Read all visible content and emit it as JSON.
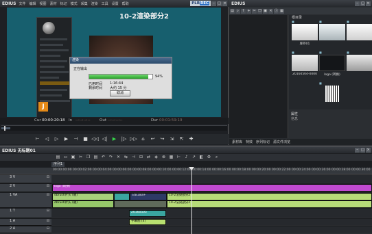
{
  "app": {
    "name": "EDIUS",
    "badge_plr": "PLR",
    "badge_rec": "REC"
  },
  "player": {
    "menu": [
      "文件",
      "编辑",
      "视图",
      "素材",
      "标记",
      "模式",
      "采集",
      "渲染",
      "工具",
      "设置",
      "帮助"
    ],
    "video_title": "10-2渲染部分2",
    "timecodes": {
      "cur_label": "Cur",
      "cur_value": "00:00:20:18",
      "in_label": "In",
      "in_value": "--:--:--:--",
      "out_label": "Out",
      "out_value": "--:--:--:--",
      "dur_label": "Dur",
      "dur_value": "00:01:59:19"
    },
    "scrub_progress": 0.04,
    "transport": [
      "⊢",
      "◁",
      "▷",
      "▶",
      "⊣",
      "■",
      "◁◁",
      "◁|",
      "▶",
      "|▷",
      "▷▷",
      "⌂",
      "↩",
      "↪",
      "⇲",
      "⇱",
      "✚"
    ]
  },
  "render_dialog": {
    "title": "渲染",
    "status": "正在输出",
    "progress": 0.94,
    "percent_text": "94%",
    "elapsed_label": "已用时间",
    "elapsed_value": "1:16:44",
    "remaining_label": "剩余时间",
    "remaining_value": "大约 15 分",
    "cancel_label": "取消"
  },
  "bin": {
    "title": "EDIUS",
    "path": "根目录",
    "clips": [
      {
        "num": "■",
        "name": "库存01",
        "thumb": "#d9d9d9"
      },
      {
        "num": "■",
        "name": "",
        "thumb": "#cfd8dc"
      },
      {
        "num": "■",
        "name": "",
        "thumb": "#e6e6e6"
      },
      {
        "num": "■",
        "name": "",
        "thumb": "#cfcfcf"
      },
      {
        "num": "■",
        "name": "20160504-0000",
        "thumb": "#222"
      },
      {
        "num": "■",
        "name": "logo (转换)",
        "thumb": "#16181b"
      },
      {
        "num": "■",
        "name": "",
        "thumb": "#dcdcdc"
      }
    ],
    "props_label": "属性",
    "props_sub": "信息",
    "tabs": [
      "素材库",
      "特效",
      "序列标记",
      "源文件浏览"
    ]
  },
  "timeline": {
    "title": "EDIUS  无标题01",
    "sequence_tab": "序列1",
    "ruler_ticks": [
      "00:00:00:00",
      "00:00:02:00",
      "00:00:04:00",
      "00:00:06:00",
      "00:00:08:00",
      "00:00:10:00",
      "00:00:12:00",
      "00:00:14:00",
      "00:00:16:00",
      "00:00:18:00",
      "00:00:20:00",
      "00:00:22:00",
      "00:00:24:00",
      "00:00:26:00",
      "00:00:28:00",
      "00:00:30:00"
    ],
    "tracks": [
      {
        "name": "3 V",
        "icon": "⊟"
      },
      {
        "name": "2 V",
        "icon": "⊟"
      },
      {
        "name": "1 VA",
        "icon": "⊟"
      },
      {
        "name": "1 T",
        "icon": "⊟"
      },
      {
        "name": "1 A",
        "icon": "⊟"
      },
      {
        "name": "2 A",
        "icon": "⊟"
      }
    ],
    "clips": {
      "logo": "logo (转换)",
      "c1": "dbrush片头 (磁)",
      "c2": "dbrush片头 (磁)",
      "c3": "StB1809-",
      "c4": "10-2渲染部分2",
      "c5": "10-2渲染部分2",
      "c6": "20160505",
      "c7": "字幕图 (4)"
    }
  },
  "colors": {
    "accent_green": "#36d64a",
    "clip_green": "#9fd06a",
    "clip_magenta": "#c04ad0",
    "clip_teal": "#3aa6a0",
    "clip_lime": "#b8e070"
  }
}
